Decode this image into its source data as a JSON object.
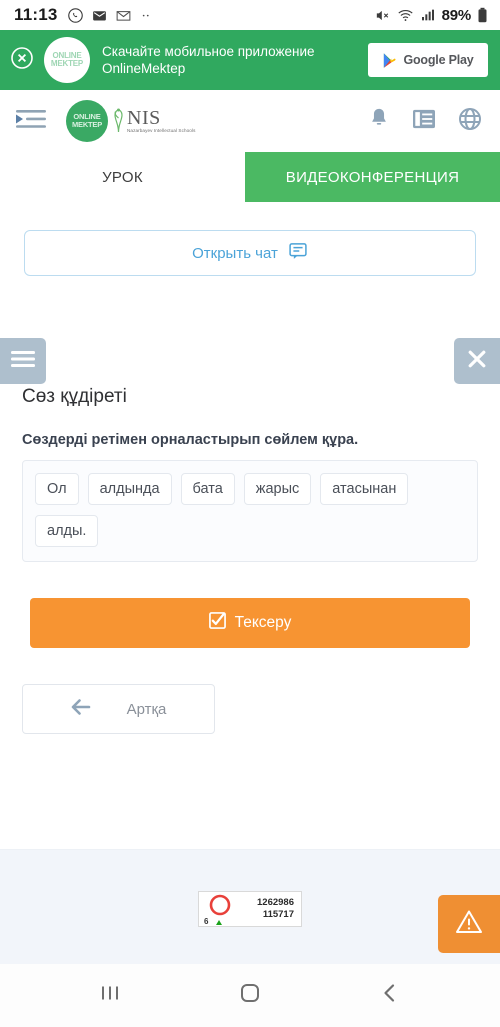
{
  "statusbar": {
    "time": "11:13",
    "battery": "89%",
    "left_icons": [
      "whatsapp-icon",
      "mail-icon",
      "gmail-icon",
      "more-dots-icon"
    ],
    "right_icons": [
      "mute-icon",
      "wifi-icon",
      "signal-icon",
      "battery-icon"
    ]
  },
  "promo_banner": {
    "close_icon": "close-circle-icon",
    "logo_line1": "ONLINE",
    "logo_line2": "MEKTEP",
    "text": "Скачайте мобильное приложение OnlineMektep",
    "store_button_label": "Google Play",
    "bg_color": "#30a95f"
  },
  "appbar": {
    "menu_icon": "indent-menu-icon",
    "brand_line1": "ONLINE",
    "brand_line2": "MEKTEP",
    "nis_abbr": "NIS",
    "nis_sub": "Nazarbayev Intellectual Schools",
    "actions": [
      {
        "name": "notifications-icon",
        "label": "bell"
      },
      {
        "name": "journal-icon",
        "label": "list"
      },
      {
        "name": "language-icon",
        "label": "globe"
      }
    ]
  },
  "tabs": [
    {
      "label": "УРОК",
      "active": false
    },
    {
      "label": "ВИДЕОКОНФЕРЕНЦИЯ",
      "active": true
    }
  ],
  "chat": {
    "label": "Открыть чат",
    "icon": "chat-bubble-icon",
    "accent_color": "#4ba3d8"
  },
  "lesson": {
    "menu_icon": "hamburger-icon",
    "close_icon": "close-icon",
    "title": "Сөз құдіреті",
    "question": "Сөздерді ретімен орналастырып сөйлем құра.",
    "words": [
      "Ол",
      "алдында",
      "бата",
      "жарыс",
      "атасынан",
      "алды."
    ],
    "check_label": "Тексеру",
    "check_icon": "checkbox-checked-icon",
    "check_color": "#f79432",
    "back_label": "Артқа",
    "back_icon": "arrow-left-icon"
  },
  "footer": {
    "counter_number": "6",
    "counter_digits_line1": "1262986",
    "counter_digits_line2": "115717",
    "warn_icon": "warning-triangle-icon"
  },
  "navbar": {
    "recents_icon": "recents-icon",
    "home_icon": "home-icon",
    "back_icon": "back-chevron-icon"
  }
}
